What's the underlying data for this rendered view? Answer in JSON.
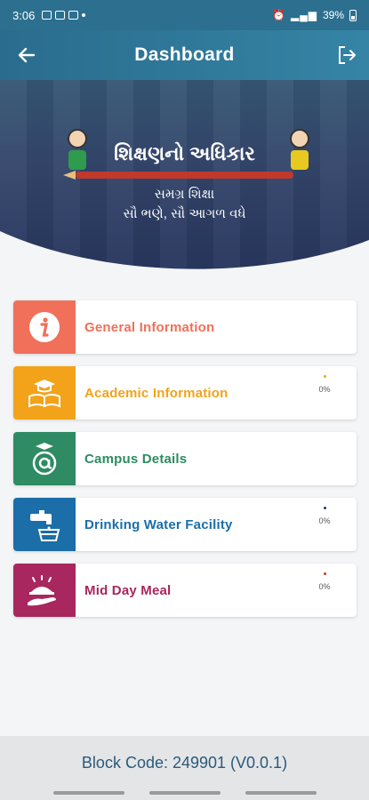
{
  "status": {
    "time": "3:06",
    "battery": "39%"
  },
  "appbar": {
    "title": "Dashboard"
  },
  "banner": {
    "title": "શિક્ષણનો અધિકાર",
    "line1": "સમગ્ર શિક્ષા",
    "line2": "સૌ ભણે, સૌ આગળ વધે"
  },
  "items": [
    {
      "label": "General Information",
      "color": "#f0705a",
      "icon": "info-icon",
      "progress": null
    },
    {
      "label": "Academic Information",
      "color": "#f2a31a",
      "icon": "graduation-book-icon",
      "progress": "0%"
    },
    {
      "label": "Campus Details",
      "color": "#2e8b63",
      "icon": "at-graduation-icon",
      "progress": null
    },
    {
      "label": "Drinking Water Facility",
      "color": "#1b6ea8",
      "icon": "water-tap-icon",
      "progress": "0%"
    },
    {
      "label": "Mid Day Meal",
      "color": "#a8275e",
      "icon": "meal-cloche-icon",
      "progress": "0%"
    }
  ],
  "footer": {
    "block_code": "Block Code: 249901 (V0.0.1)"
  }
}
